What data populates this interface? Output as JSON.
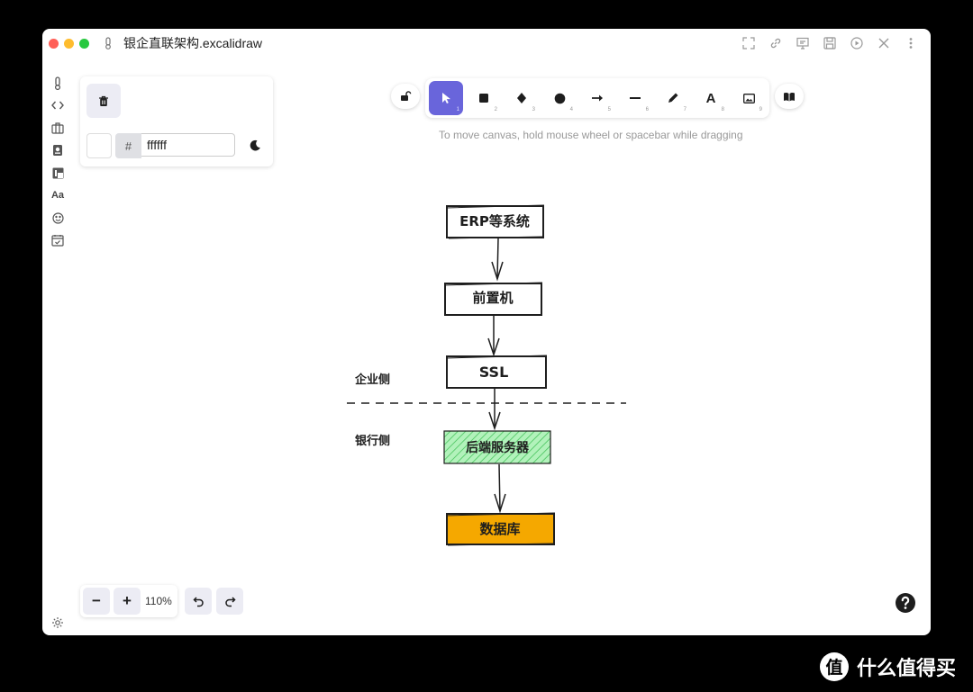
{
  "window": {
    "title": "银企直联架构.excalidraw"
  },
  "title_actions": [
    "fullscreen-icon",
    "link-icon",
    "presentation-icon",
    "save-icon",
    "play-icon",
    "close-icon",
    "more-icon"
  ],
  "sidebar": [
    "thermometer-icon",
    "code-icon",
    "briefcase-icon",
    "document-icon",
    "hex-icon",
    "font-icon",
    "smiley-icon",
    "calendar-check-icon"
  ],
  "sidebar_font_label": "Aa",
  "properties": {
    "hash": "#",
    "bg_hex": "ffffff"
  },
  "toolbar": {
    "tools": [
      {
        "name": "selection",
        "key": "1"
      },
      {
        "name": "rectangle",
        "key": "2"
      },
      {
        "name": "diamond",
        "key": "3"
      },
      {
        "name": "ellipse",
        "key": "4"
      },
      {
        "name": "arrow",
        "key": "5"
      },
      {
        "name": "line",
        "key": "6"
      },
      {
        "name": "draw",
        "key": "7"
      },
      {
        "name": "text",
        "key": "8",
        "glyph": "A"
      },
      {
        "name": "image",
        "key": "9"
      }
    ],
    "active": "selection",
    "hint": "To move canvas, hold mouse wheel or spacebar while dragging"
  },
  "zoom": {
    "minus": "−",
    "plus": "+",
    "level": "110%"
  },
  "diagram": {
    "nodes": [
      {
        "id": "erp",
        "label": "ERP等系统",
        "fill": "#ffffff"
      },
      {
        "id": "frontend",
        "label": "前置机",
        "fill": "#ffffff"
      },
      {
        "id": "ssl",
        "label": "SSL",
        "fill": "#ffffff"
      },
      {
        "id": "backend",
        "label": "后端服务器",
        "fill": "#b2f2bb"
      },
      {
        "id": "database",
        "label": "数据库",
        "fill": "#f5a800"
      }
    ],
    "zones": {
      "enterprise": "企业侧",
      "bank": "银行侧"
    }
  },
  "colors": {
    "accent": "#6965db",
    "hatch_green": "#40c057"
  },
  "watermark": {
    "text": "什么值得买",
    "logo": "值"
  }
}
